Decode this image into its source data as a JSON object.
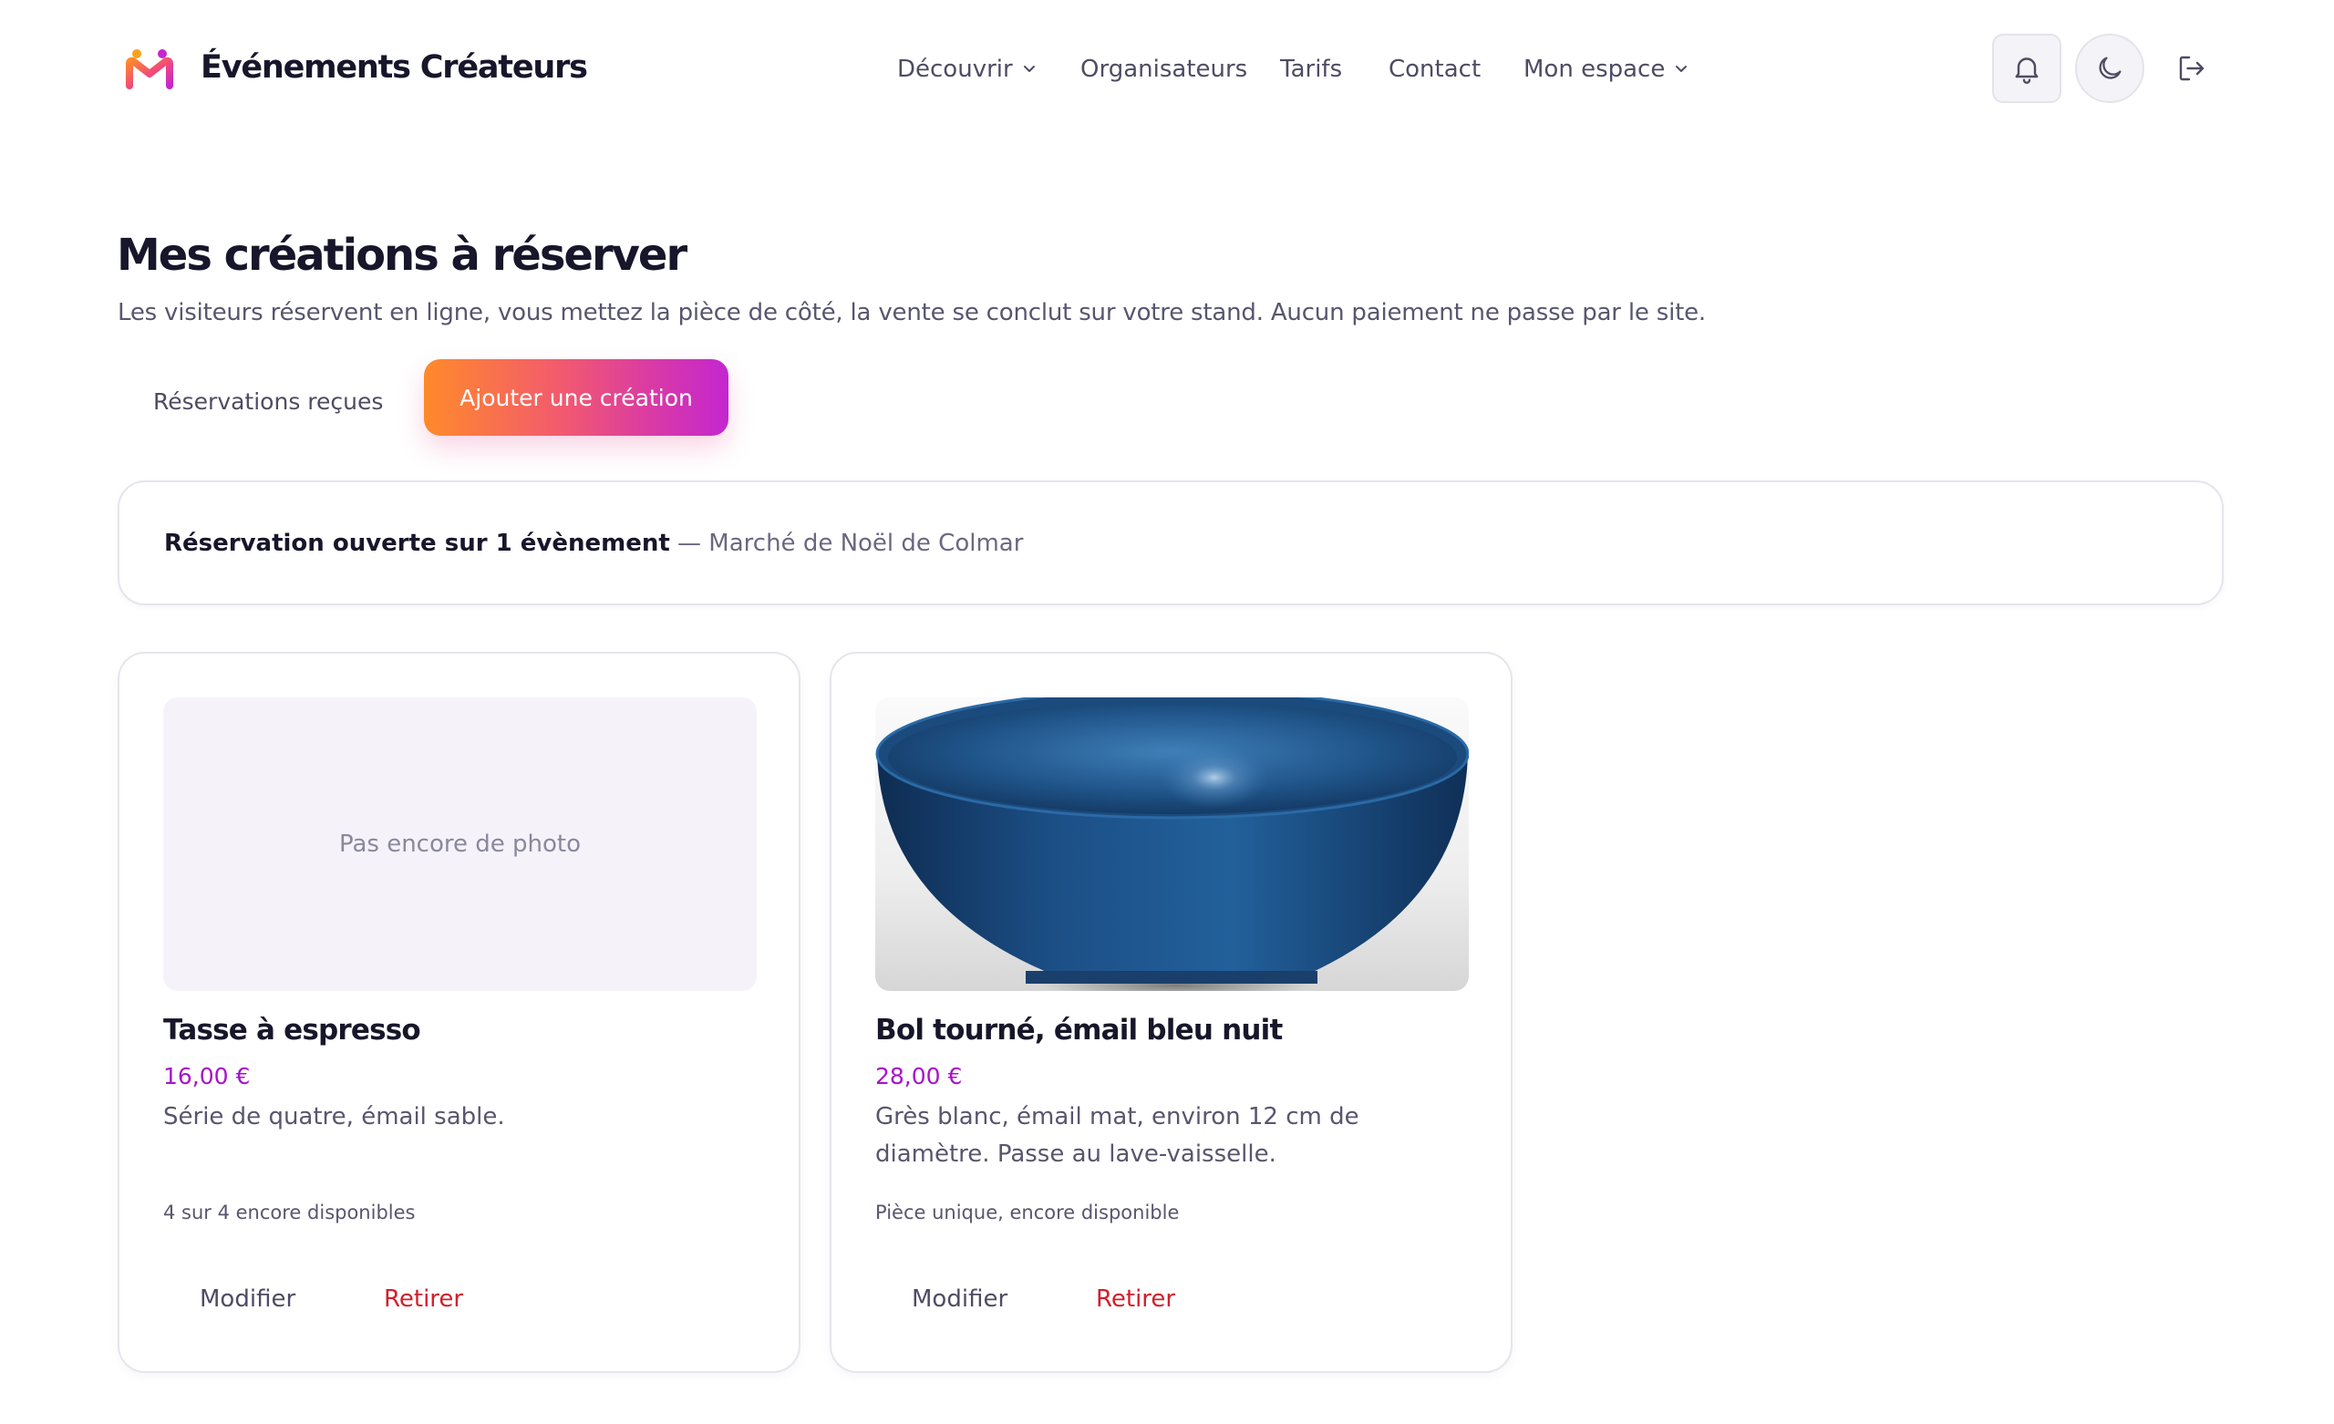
{
  "header": {
    "brand": "Événements Créateurs",
    "logo_icon": "brand-logo-icon",
    "nav": [
      {
        "label": "Découvrir",
        "dropdown": true
      },
      {
        "label": "Organisateurs",
        "dropdown": false
      },
      {
        "label": "Tarifs",
        "dropdown": false
      },
      {
        "label": "Contact",
        "dropdown": false
      },
      {
        "label": "Mon espace",
        "dropdown": true
      }
    ],
    "icons": [
      "bell-icon",
      "moon-icon",
      "logout-icon"
    ]
  },
  "page": {
    "title": "Mes créations à réserver",
    "subtitle": "Les visiteurs réservent en ligne, vous mettez la pièce de côté, la vente se conclut sur votre stand. Aucun paiement ne passe par le site."
  },
  "actions": {
    "reservations_label": "Réservations reçues",
    "add_label": "Ajouter une création"
  },
  "banner": {
    "strong": "Réservation ouverte sur 1 évènement",
    "muted": " — Marché de Noël de Colmar"
  },
  "creations": [
    {
      "title": "Tasse à espresso",
      "price": "16,00 €",
      "description": "Série de quatre, émail sable.",
      "stock": "4 sur 4 encore disponibles",
      "has_photo": false,
      "placeholder": "Pas encore de photo",
      "edit_label": "Modifier",
      "remove_label": "Retirer"
    },
    {
      "title": "Bol tourné, émail bleu nuit",
      "price": "28,00 €",
      "description": "Grès blanc, émail mat, environ 12 cm de diamètre. Passe au lave-vaisselle.",
      "stock": "Pièce unique, encore disponible",
      "has_photo": true,
      "photo_subject": "blue-glazed-bowl",
      "edit_label": "Modifier",
      "remove_label": "Retirer"
    }
  ],
  "colors": {
    "accent_gradient": [
      "#ff8a2a",
      "#f25a6e",
      "#c426d0"
    ],
    "price": "#a614c9",
    "danger": "#d21f2a",
    "text": "#17162a",
    "muted": "#58566e"
  }
}
